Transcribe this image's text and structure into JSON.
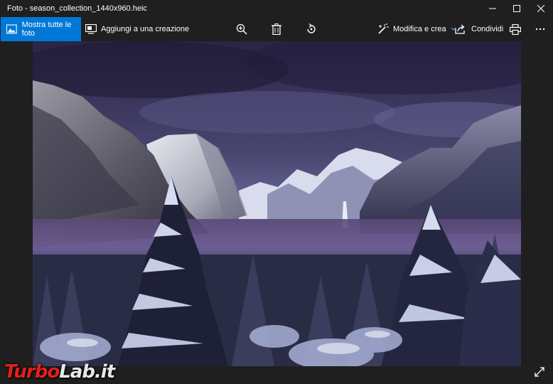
{
  "window": {
    "title": "Foto - season_collection_1440x960.heic"
  },
  "toolbar": {
    "show_all_label": "Mostra tutte le foto",
    "add_to_creation_label": "Aggiungi a una creazione",
    "edit_create_label": "Modifica e crea",
    "share_label": "Condividi"
  },
  "watermark": {
    "part1": "Turbo",
    "part2": "Lab.it"
  },
  "colors": {
    "accent": "#0078d7",
    "background": "#1f1f1f",
    "watermark_red": "#e3201b"
  },
  "icons": {
    "show_all": "photo-icon",
    "add_to_creation": "slideshow-icon",
    "zoom": "zoom-in-icon",
    "delete": "trash-icon",
    "rotate": "rotate-icon",
    "edit": "magic-wand-icon",
    "share": "share-icon",
    "print": "printer-icon",
    "more": "more-icon",
    "expand": "expand-icon"
  }
}
